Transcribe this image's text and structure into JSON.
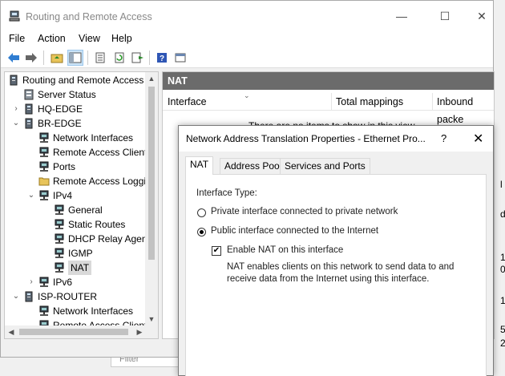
{
  "window": {
    "title": "Routing and Remote Access",
    "minimize_glyph": "—",
    "maximize_glyph": "☐",
    "close_glyph": "✕"
  },
  "menu": [
    "File",
    "Action",
    "View",
    "Help"
  ],
  "toolbar": [
    "back-icon",
    "forward-icon",
    "up-folder-icon",
    "show-hide-tree-icon",
    "export-list-icon",
    "refresh-icon",
    "properties-icon",
    "help-icon",
    "console-icon"
  ],
  "tree": {
    "root": "Routing and Remote Access",
    "items": [
      {
        "label": "Server Status"
      },
      {
        "label": "HQ-EDGE"
      },
      {
        "label": "BR-EDGE"
      },
      {
        "label": "Network Interfaces"
      },
      {
        "label": "Remote Access Clients"
      },
      {
        "label": "Ports"
      },
      {
        "label": "Remote Access Logging"
      },
      {
        "label": "IPv4"
      },
      {
        "label": "General"
      },
      {
        "label": "Static Routes"
      },
      {
        "label": "DHCP Relay Agent"
      },
      {
        "label": "IGMP"
      },
      {
        "label": "NAT"
      },
      {
        "label": "IPv6"
      },
      {
        "label": "ISP-ROUTER"
      },
      {
        "label": "Network Interfaces"
      },
      {
        "label": "Remote Access Clients"
      }
    ]
  },
  "details": {
    "header": "NAT",
    "columns": [
      "Interface",
      "Total mappings",
      "Inbound packe"
    ],
    "empty_message": "There are no items to show in this view."
  },
  "filter_placeholder": "Filter",
  "dialog": {
    "title": "Network Address Translation Properties - Ethernet Pro...",
    "help_glyph": "?",
    "close_glyph": "✕",
    "tabs": [
      "NAT",
      "Address Pool",
      "Services and Ports"
    ],
    "interface_type_label": "Interface Type:",
    "radio_private": "Private interface connected to private network",
    "radio_public": "Public interface connected to the Internet",
    "enable_nat_label": "Enable NAT on this interface",
    "enable_nat_checked": true,
    "description": "NAT enables clients on this network to send data to and receive data from the Internet using this interface."
  },
  "background_fragments": [
    "l",
    "d",
    "1",
    "0",
    "1",
    "5",
    "2"
  ]
}
